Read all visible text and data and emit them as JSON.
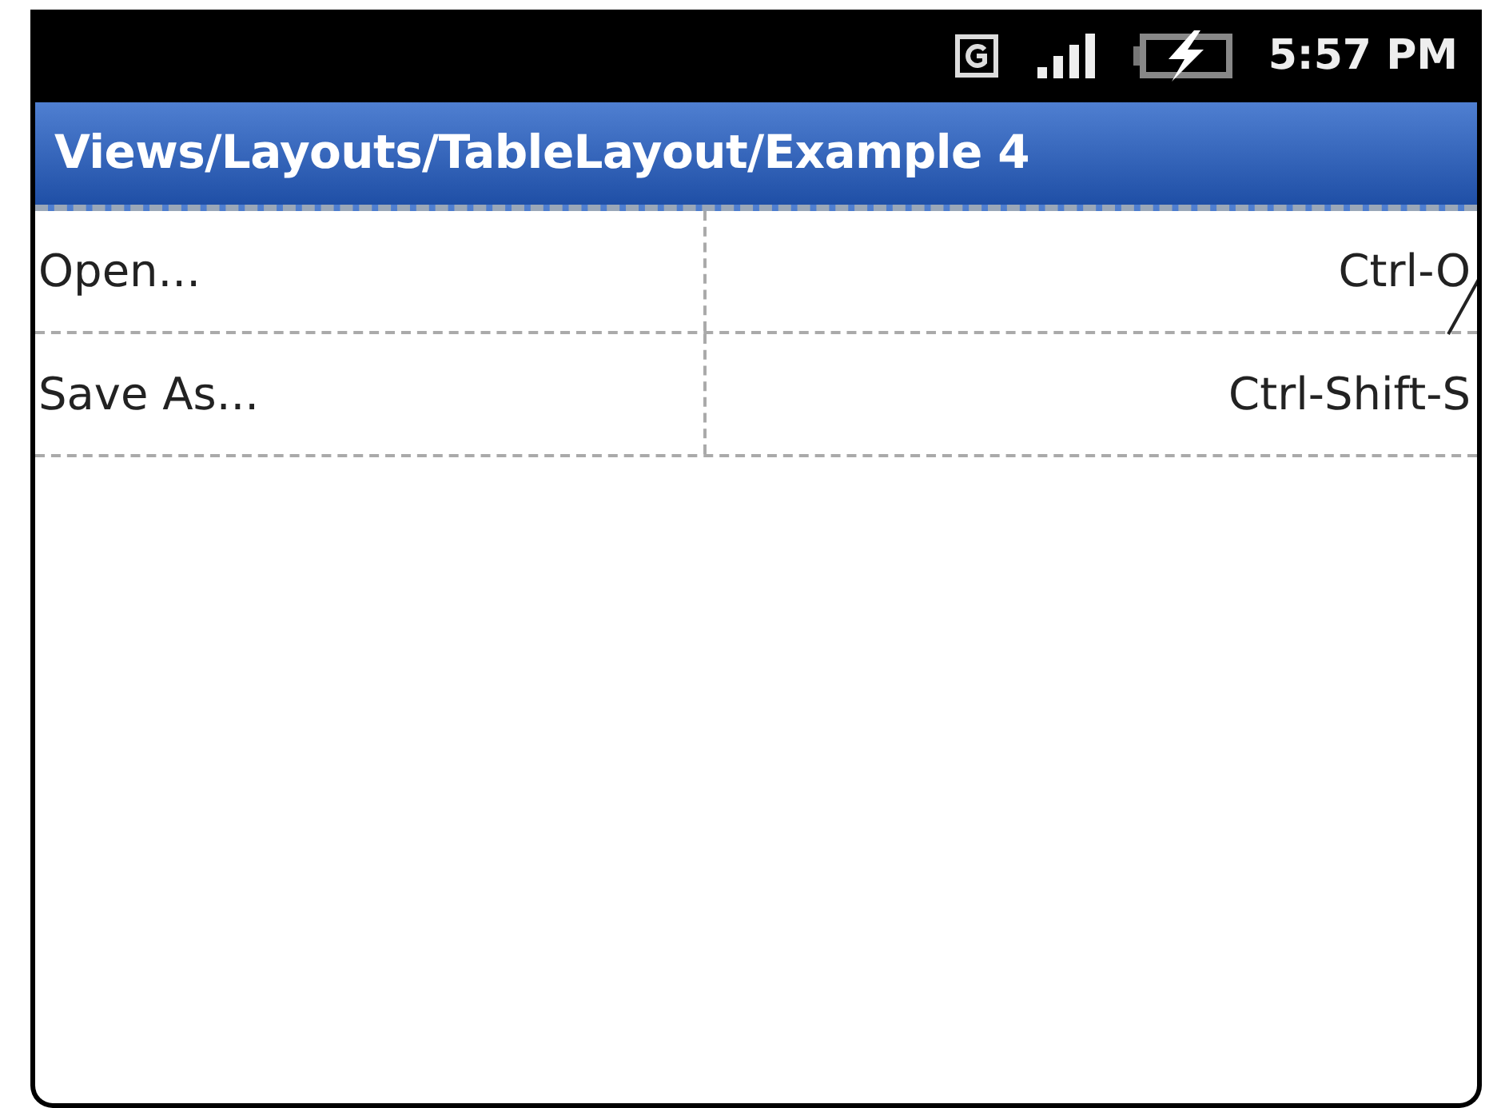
{
  "status_bar": {
    "time": "5:57 PM"
  },
  "window": {
    "title": "Views/Layouts/TableLayout/Example 4"
  },
  "table": {
    "rows": [
      {
        "cells": [
          "Open...",
          "Ctrl-O"
        ]
      },
      {
        "cells": [
          "Save As...",
          "Ctrl-Shift-S"
        ]
      }
    ]
  }
}
